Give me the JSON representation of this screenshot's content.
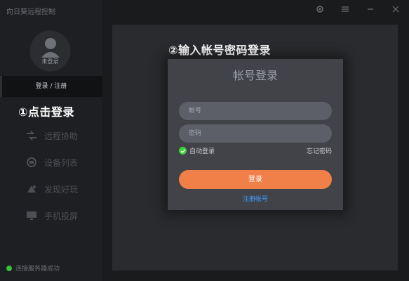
{
  "app": {
    "title": "向日葵远程控制"
  },
  "titlebar": {
    "icons": [
      "gear-icon",
      "menu-icon",
      "minimize-icon",
      "close-icon"
    ]
  },
  "sidebar": {
    "avatar_status": "未登录",
    "login_button": "登录 / 注册",
    "nav": [
      {
        "label": "远程协助",
        "icon": "remote-assist-icon"
      },
      {
        "label": "设备列表",
        "icon": "device-list-icon"
      },
      {
        "label": "发现好玩",
        "icon": "discover-icon"
      },
      {
        "label": "手机投屏",
        "icon": "screen-cast-icon"
      }
    ],
    "status": "连接服务器成功"
  },
  "annotations": {
    "step1": "①点击登录",
    "step2": "②输入帐号密码登录"
  },
  "login": {
    "title": "帐号登录",
    "account_placeholder": "帐号",
    "password_placeholder": "密码",
    "auto_login": "自动登录",
    "auto_login_checked": true,
    "forgot_password": "忘记密码",
    "submit": "登录",
    "register": "注册帐号"
  },
  "colors": {
    "accent": "#f07f48",
    "link": "#3aa0ff",
    "success": "#36c23a",
    "background": "#1a1b1d",
    "sidebar": "#1e1f22",
    "dialog": "#414349"
  }
}
